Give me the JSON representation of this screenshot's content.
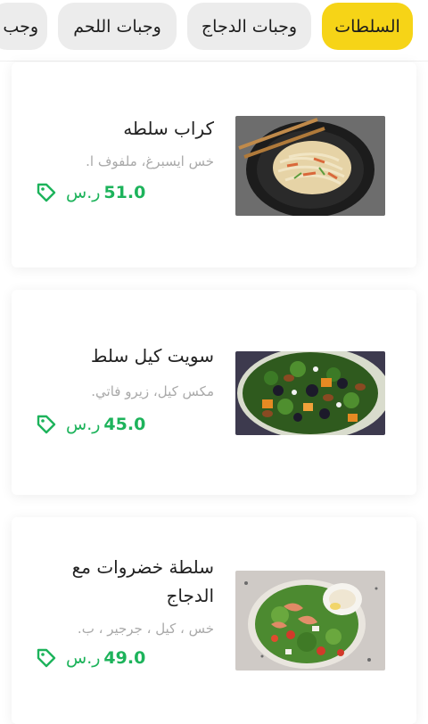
{
  "tabs": [
    {
      "label": "السلطات",
      "active": true
    },
    {
      "label": "وجبات الدجاج",
      "active": false
    },
    {
      "label": "وجبات اللحم",
      "active": false
    },
    {
      "label": "وجب",
      "active": false
    }
  ],
  "colors": {
    "accent": "#f6d417",
    "price": "#1db35b",
    "muted": "#a9a9a9"
  },
  "items": [
    {
      "title": "كراب سلطه",
      "description": "خس ايسبرغ، ملفوف ا.",
      "price": "51.0",
      "currency": "ر.س",
      "icon": "price-tag-icon"
    },
    {
      "title": "سويت كيل سلط",
      "description": "مكس كيل، زيرو فاتي.",
      "price": "45.0",
      "currency": "ر.س",
      "icon": "price-tag-icon"
    },
    {
      "title": "سلطة خضروات مع الدجاج",
      "description": "خس ، كيل ، جرجير ، ب.",
      "price": "49.0",
      "currency": "ر.س",
      "icon": "price-tag-icon"
    }
  ]
}
